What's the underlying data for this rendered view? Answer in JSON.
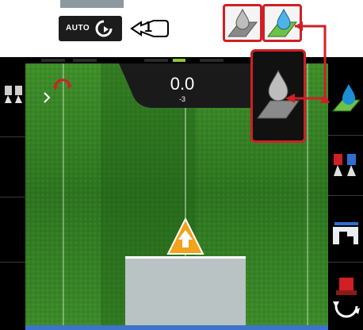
{
  "auto_button": {
    "label": "AUTO"
  },
  "callout": {
    "number": "1"
  },
  "readout": {
    "value": "0.0",
    "sub": "-3"
  },
  "colors": {
    "accent_red": "#d01f25",
    "field_green": "#2f7a1f",
    "guidance_blue": "#3b74c9",
    "arrow_orange": "#f2a21c",
    "drop_blue": "#1a8fd6"
  },
  "icons": {
    "left": [
      "nozzle-pair-icon",
      "rotate-arrow-icon"
    ],
    "right": [
      "drop-on-layer-icon",
      "section-nozzles-icon",
      "boom-height-icon",
      "tractor-rotate-icon"
    ],
    "top": [
      "auto-rotate-icon",
      "grey-drop-layer-icon",
      "green-drop-layer-icon"
    ]
  }
}
